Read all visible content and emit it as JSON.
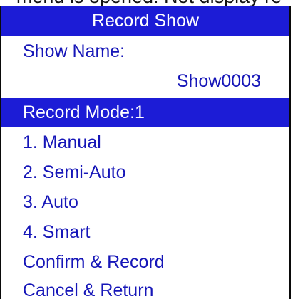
{
  "caption": "menu is opened. Not display re",
  "menu": {
    "title": "Record Show",
    "show_name_label": "Show Name:",
    "show_name_value": "Show0003",
    "record_mode_label": "Record Mode:1",
    "options": [
      "1. Manual",
      "2. Semi-Auto",
      "3. Auto",
      "4. Smart"
    ],
    "confirm_label": "Confirm & Record",
    "cancel_label": "Cancel & Return"
  },
  "colors": {
    "highlight": "#1c1cd6",
    "text": "#1616b8",
    "border": "#0a0a0a"
  }
}
